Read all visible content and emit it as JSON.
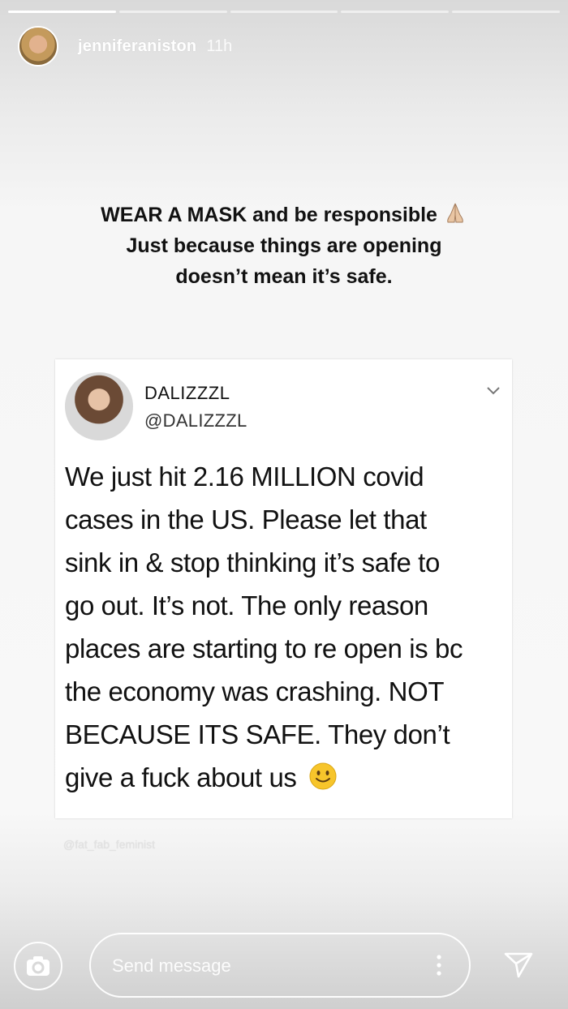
{
  "story": {
    "progress_segments": 5,
    "progress_completed": 1,
    "username": "jenniferaniston",
    "time": "11h",
    "caption_lines": [
      "WEAR A MASK and be responsible",
      "Just because things are opening",
      "doesn’t mean it’s safe."
    ],
    "caption_emoji": "pray-icon"
  },
  "tweet": {
    "name": "DALIZZZL",
    "handle": "@DALIZZZL",
    "lines": [
      "We just hit 2.16 MILLION covid",
      "cases in the US. Please let that",
      "sink in & stop thinking it’s safe to",
      "go out. It’s not. The only reason",
      "places are starting to re open is bc",
      "the economy was crashing. NOT",
      "BECAUSE ITS SAFE. They don’t",
      "give a fuck about us"
    ],
    "end_emoji": "slightly-smiling-face-icon"
  },
  "credit": "@fat_fab_feminist",
  "composer": {
    "placeholder": "Send message"
  },
  "colors": {
    "text": "#111111",
    "overlay_white": "#ffffff",
    "emoji_yellow": "#f7c52b"
  }
}
